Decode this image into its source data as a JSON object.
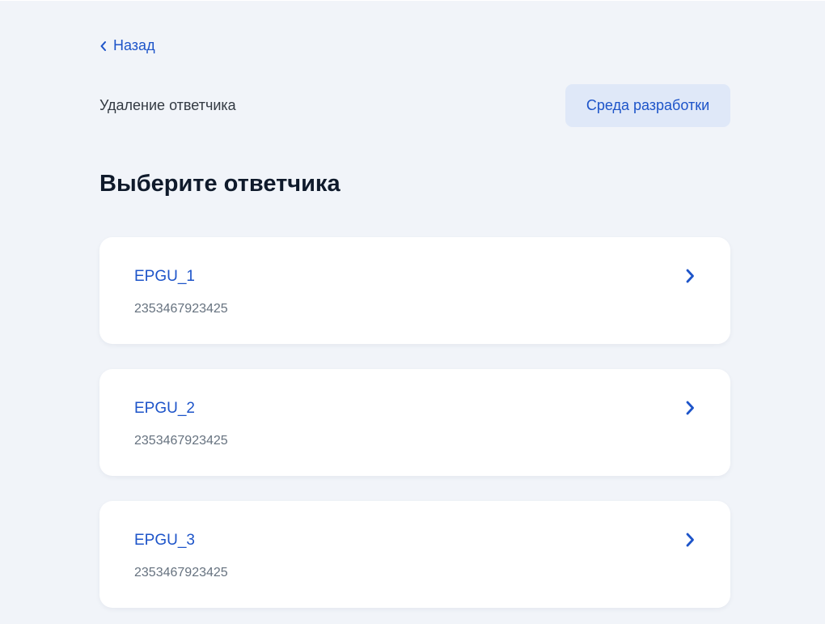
{
  "nav": {
    "back_label": "Назад"
  },
  "header": {
    "service_title": "Удаление ответчика",
    "environment_badge": "Среда разработки"
  },
  "main": {
    "title": "Выберите ответчика",
    "respondents": [
      {
        "name": "EPGU_1",
        "id": "2353467923425"
      },
      {
        "name": "EPGU_2",
        "id": "2353467923425"
      },
      {
        "name": "EPGU_3",
        "id": "2353467923425"
      }
    ]
  },
  "icons": {
    "back": "chevron-left-icon",
    "card_action": "chevron-right-icon"
  },
  "colors": {
    "accent": "#1d54c9",
    "background": "#f1f4f9",
    "badge_background": "#dfe8f8",
    "card_background": "#ffffff",
    "title_text": "#0f1a2b",
    "secondary_text": "#66727f"
  }
}
